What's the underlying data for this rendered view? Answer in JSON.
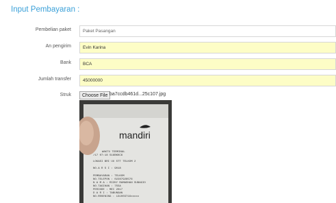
{
  "form": {
    "heading": "Input Pembayaran :",
    "fields": [
      {
        "label": "Pembelian paket",
        "value": "Paket Pasangan"
      },
      {
        "label": "An pengirim",
        "value": "Evin Karina"
      },
      {
        "label": "Bank",
        "value": "BCA"
      },
      {
        "label": "Jumlah transfer",
        "value": "45000000"
      }
    ],
    "struk": {
      "label": "Struk",
      "button": "Choose File",
      "filename": "ba7ccdb461d...25c107.jpg"
    }
  },
  "receipt": {
    "brand": "mandiri",
    "lines": [
      "WAKTU    TERMINAL",
      "/17  07:18   S16BKKC6",
      "LOKASI    BRI UU STT TELKOM 2",
      "NO.A R S I  :  9018",
      "PEMBAYARAN   : TELKOM",
      "NO.TELEPON   : 02287928576",
      "N A M A      : RIZKY RAMADHAN SUBAGIO",
      "NO.TAGIHAN   : 755A",
      "PERIODE      : MEI 2017",
      "D A R I      : TABUNGAN",
      "NO.REKENING  : 131003716xxxxx"
    ]
  },
  "colors": {
    "accent": "#3aa0d8",
    "input_yellow": "#fdfdc6",
    "border": "#d6d6d6"
  }
}
